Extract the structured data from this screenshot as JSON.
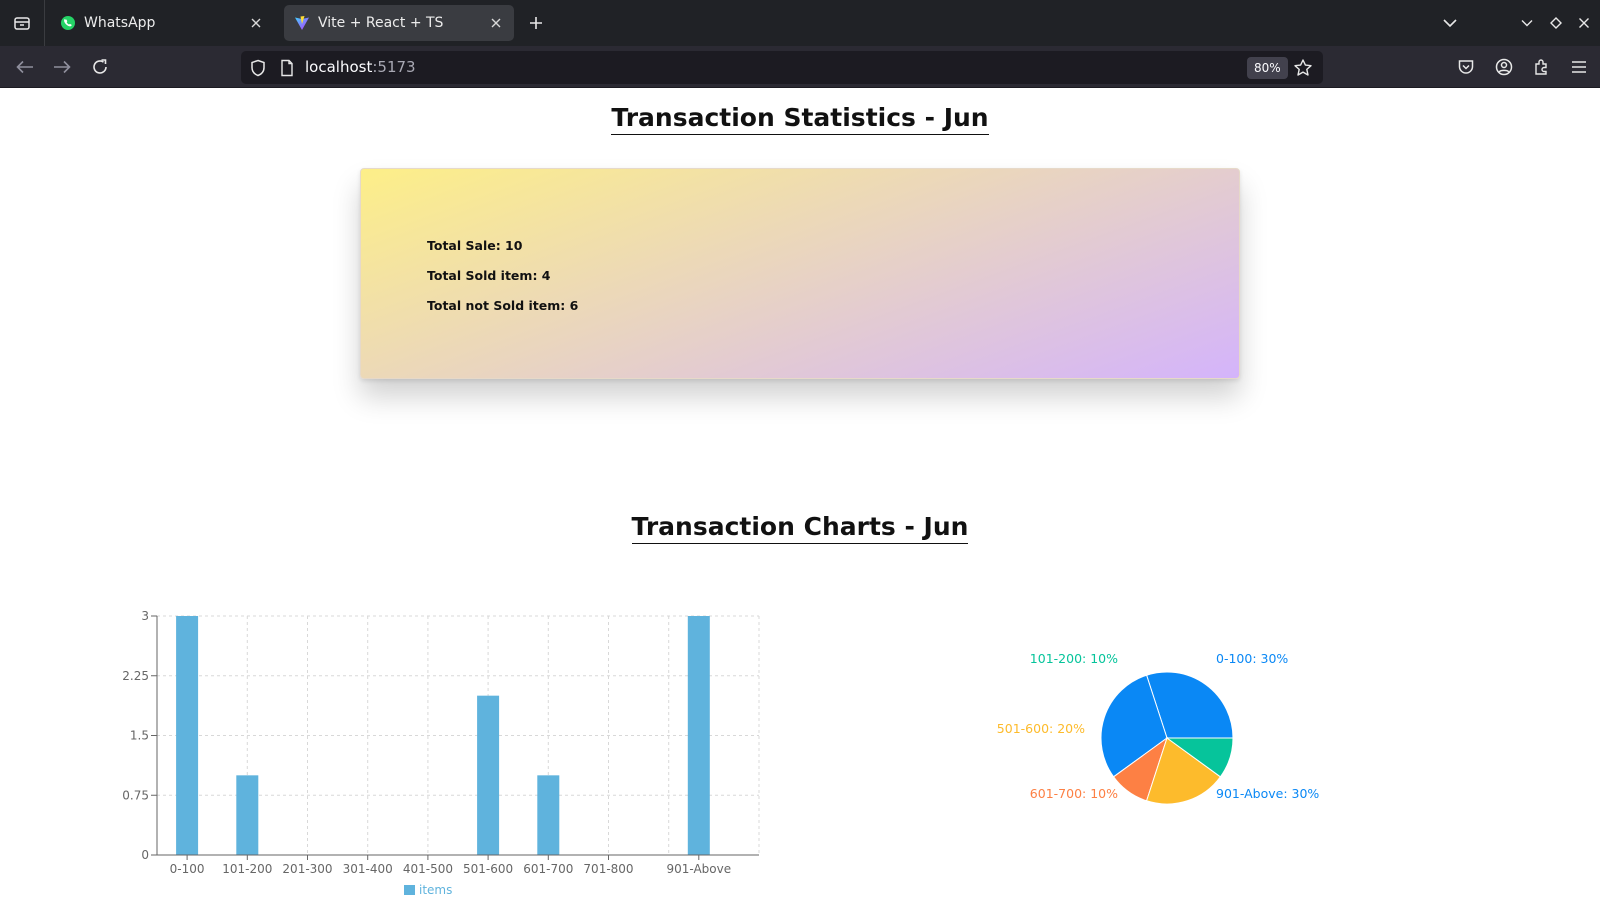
{
  "browser": {
    "tabs": [
      {
        "title": "WhatsApp",
        "favicon": "whatsapp-icon",
        "active": false
      },
      {
        "title": "Vite + React + TS",
        "favicon": "vite-icon",
        "active": true
      }
    ],
    "url_host": "localhost",
    "url_port": ":5173",
    "zoom": "80%"
  },
  "statistics": {
    "title": "Transaction Statistics - Jun",
    "total_sale": "Total Sale: 10",
    "total_sold": "Total Sold item: 4",
    "total_not_sold": "Total not Sold item: 6"
  },
  "charts_section": {
    "title": "Transaction Charts - Jun"
  },
  "chart_data": [
    {
      "type": "bar",
      "categories": [
        "0-100",
        "101-200",
        "201-300",
        "301-400",
        "401-500",
        "501-600",
        "601-700",
        "701-800",
        "901-Above"
      ],
      "series": [
        {
          "name": "items",
          "values": [
            3,
            1,
            0,
            0,
            0,
            2,
            1,
            0,
            3
          ],
          "color": "#5fb3dd"
        }
      ],
      "yticks": [
        "0",
        "0.75",
        "1.5",
        "2.25",
        "3"
      ],
      "ylim": [
        0,
        3
      ],
      "grid": true,
      "legend": "bottom"
    },
    {
      "type": "pie",
      "slices": [
        {
          "label": "0-100: 30%",
          "value": 30,
          "color": "#0a88f5"
        },
        {
          "label": "901-Above: 30%",
          "value": 30,
          "color": "#0a88f5"
        },
        {
          "label": "601-700: 10%",
          "value": 10,
          "color": "#fd8044"
        },
        {
          "label": "501-600: 20%",
          "value": 20,
          "color": "#fdbb2c"
        },
        {
          "label": "101-200: 10%",
          "value": 10,
          "color": "#06c49b"
        }
      ]
    }
  ]
}
